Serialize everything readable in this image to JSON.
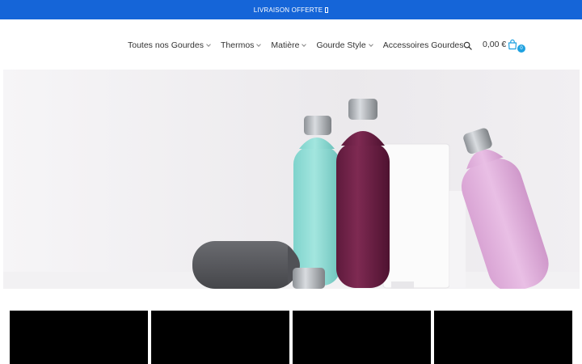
{
  "promo": {
    "text": "LIVRAISON OFFERTE"
  },
  "nav": {
    "items": [
      {
        "label": "Toutes nos Gourdes",
        "has_dropdown": true
      },
      {
        "label": "Thermos",
        "has_dropdown": true
      },
      {
        "label": "Matière",
        "has_dropdown": true
      },
      {
        "label": "Gourde Style",
        "has_dropdown": true
      },
      {
        "label": "Accessoires Gourdes",
        "has_dropdown": false
      }
    ]
  },
  "cart": {
    "total": "0,00 €",
    "count": "0"
  },
  "icons": {
    "search": "search-icon",
    "cart": "shopping-bag-icon"
  },
  "colors": {
    "promo_bar": "#1565d8",
    "cart_badge": "#1ea1e0",
    "tiles": "#000000"
  },
  "hero": {
    "image": "water-bottles-photo"
  },
  "categories": {
    "tile_count": 4
  }
}
